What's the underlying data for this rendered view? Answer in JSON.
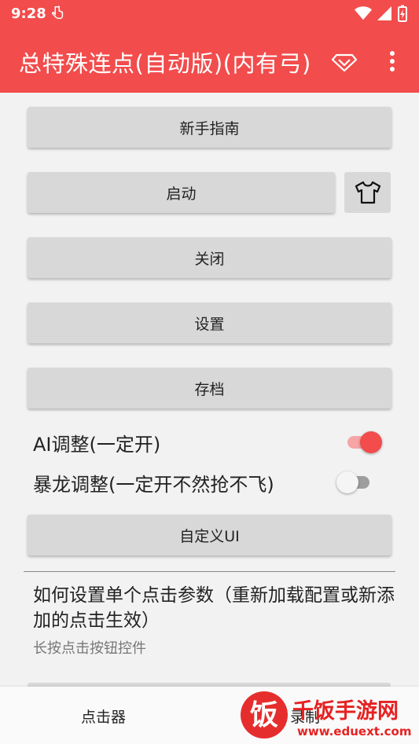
{
  "status_bar": {
    "time": "9:28"
  },
  "app_bar": {
    "title": "总特殊连点(自动版)(内有弓)"
  },
  "buttons": {
    "guide": "新手指南",
    "start": "启动",
    "close": "关闭",
    "settings": "设置",
    "save": "存档",
    "custom_ui": "自定义UI"
  },
  "switches": [
    {
      "label": "AI调整(一定开)",
      "on": true
    },
    {
      "label": "暴龙调整(一定开不然抢不飞)",
      "on": false
    }
  ],
  "help": {
    "title": "如何设置单个点击参数（重新加载配置或新添加的点击生效）",
    "subtitle": "长按点击按钮控件"
  },
  "bottom_nav": {
    "items": [
      "点击器",
      "录制"
    ]
  },
  "watermark": {
    "brand": "饭",
    "name": "千饭手游网",
    "url": "www.eduext.com"
  },
  "colors": {
    "primary": "#f24c4c",
    "button_bg": "#d8d8d8"
  }
}
